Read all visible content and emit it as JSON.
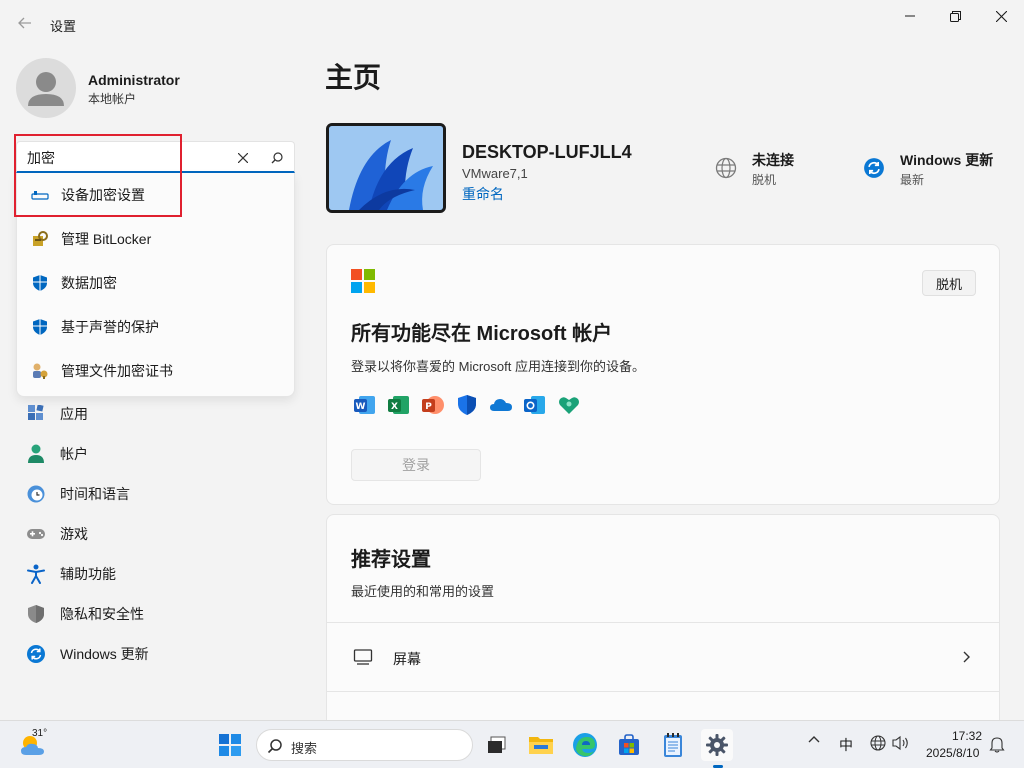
{
  "window": {
    "title": "设置",
    "back_icon": "back-arrow-icon"
  },
  "profile": {
    "name": "Administrator",
    "account_type": "本地帐户"
  },
  "search": {
    "value": "加密",
    "suggestions": [
      {
        "label": "设备加密设置",
        "icon": "key-icon"
      },
      {
        "label": "管理 BitLocker",
        "icon": "bitlocker-icon"
      },
      {
        "label": "数据加密",
        "icon": "shield-icon"
      },
      {
        "label": "基于声誉的保护",
        "icon": "shield-icon"
      },
      {
        "label": "管理文件加密证书",
        "icon": "certificate-icon"
      }
    ]
  },
  "nav": {
    "items": [
      {
        "label": "应用",
        "icon": "apps-icon"
      },
      {
        "label": "帐户",
        "icon": "account-icon"
      },
      {
        "label": "时间和语言",
        "icon": "clock-globe-icon"
      },
      {
        "label": "游戏",
        "icon": "gamepad-icon"
      },
      {
        "label": "辅助功能",
        "icon": "accessibility-icon"
      },
      {
        "label": "隐私和安全性",
        "icon": "privacy-shield-icon"
      },
      {
        "label": "Windows 更新",
        "icon": "update-icon"
      }
    ]
  },
  "main": {
    "title": "主页",
    "device": {
      "name": "DESKTOP-LUFJLL4",
      "model": "VMware7,1",
      "rename": "重命名"
    },
    "status": [
      {
        "title": "未连接",
        "sub": "脱机",
        "icon": "globe-icon"
      },
      {
        "title": "Windows 更新",
        "sub": "最新",
        "icon": "update-icon"
      }
    ],
    "ms_card": {
      "badge": "脱机",
      "title": "所有功能尽在 Microsoft 帐户",
      "description": "登录以将你喜爱的 Microsoft 应用连接到你的设备。",
      "signin": "登录",
      "apps": [
        "word-icon",
        "excel-icon",
        "powerpoint-icon",
        "defender-icon",
        "onedrive-icon",
        "outlook-icon",
        "family-icon"
      ]
    },
    "recommended": {
      "title": "推荐设置",
      "description": "最近使用的和常用的设置",
      "items": [
        {
          "label": "屏幕",
          "icon": "monitor-icon"
        }
      ]
    }
  },
  "taskbar": {
    "weather_temp": "31°",
    "search_label": "搜索",
    "tray": {
      "ime": "中"
    },
    "clock": {
      "time": "17:32",
      "date": "2025/8/10"
    }
  },
  "colors": {
    "accent": "#0067c0",
    "highlight_box": "#e0202f"
  }
}
